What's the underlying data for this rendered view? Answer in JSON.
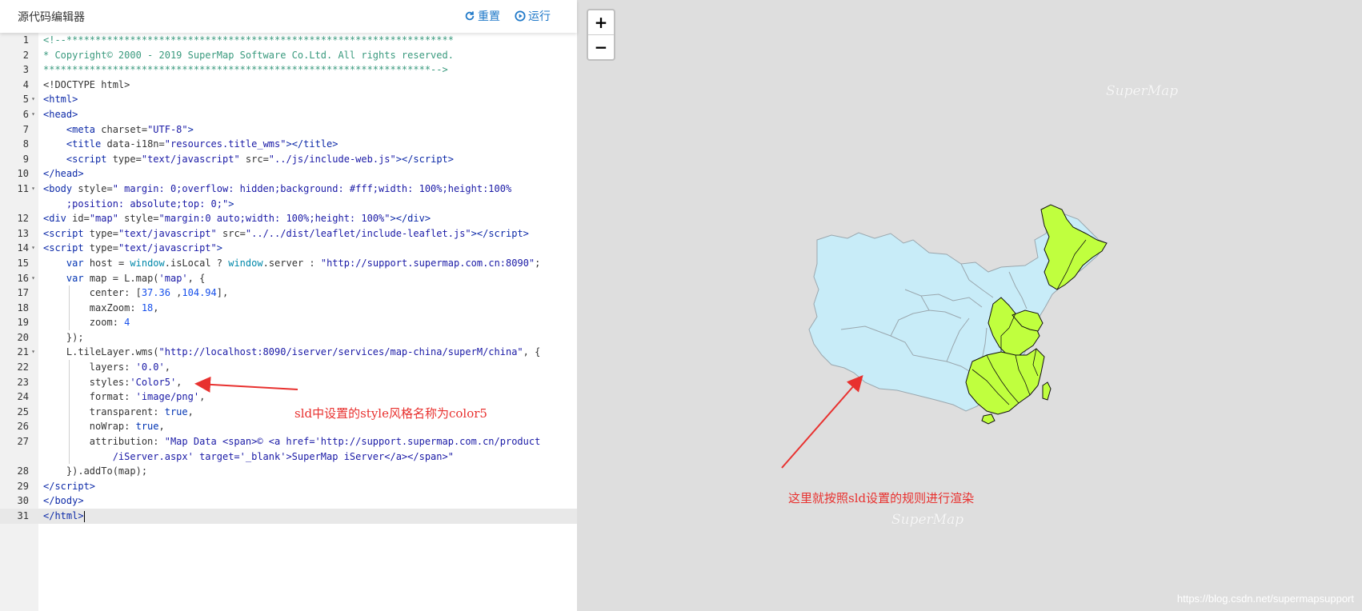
{
  "editor": {
    "title": "源代码编辑器",
    "reset_label": "重置",
    "run_label": "运行",
    "lines": [
      {
        "n": "1",
        "fold": "",
        "html": "<span class=\"c-cm\">&lt;!--*******************************************************************</span>"
      },
      {
        "n": "2",
        "fold": "",
        "html": "<span class=\"c-cm\">* Copyright© 2000 - 2019 SuperMap Software Co.Ltd. All rights reserved.</span>"
      },
      {
        "n": "3",
        "fold": "",
        "html": "<span class=\"c-cm\">*******************************************************************--&gt;</span>"
      },
      {
        "n": "4",
        "fold": "",
        "html": "&lt;!DOCTYPE html&gt;"
      },
      {
        "n": "5",
        "fold": "▾",
        "html": "<span class=\"c-tg\">&lt;html&gt;</span>"
      },
      {
        "n": "6",
        "fold": "▾",
        "html": "<span class=\"c-tg\">&lt;head&gt;</span>"
      },
      {
        "n": "7",
        "fold": "",
        "html": "    <span class=\"c-tg\">&lt;meta</span> charset=<span class=\"c-st\">\"UTF-8\"</span><span class=\"c-tg\">&gt;</span>"
      },
      {
        "n": "8",
        "fold": "",
        "html": "    <span class=\"c-tg\">&lt;title</span> data-i18n=<span class=\"c-st\">\"resources.title_wms\"</span><span class=\"c-tg\">&gt;&lt;/title&gt;</span>"
      },
      {
        "n": "9",
        "fold": "",
        "html": "    <span class=\"c-tg\">&lt;script</span> type=<span class=\"c-st\">\"text/javascript\"</span> src=<span class=\"c-st\">\"../js/include-web.js\"</span><span class=\"c-tg\">&gt;&lt;/script&gt;</span>"
      },
      {
        "n": "10",
        "fold": "",
        "html": "<span class=\"c-tg\">&lt;/head&gt;</span>"
      },
      {
        "n": "11",
        "fold": "▾",
        "html": "<span class=\"c-tg\">&lt;body</span> style=<span class=\"c-st\">\" margin: 0;overflow: hidden;background: #fff;width: 100%;height:100%</span>"
      },
      {
        "n": "",
        "fold": "",
        "html": "    <span class=\"c-st\">;position: absolute;top: 0;\"</span><span class=\"c-tg\">&gt;</span>"
      },
      {
        "n": "12",
        "fold": "",
        "html": "<span class=\"c-tg\">&lt;div</span> id=<span class=\"c-st\">\"map\"</span> style=<span class=\"c-st\">\"margin:0 auto;width: 100%;height: 100%\"</span><span class=\"c-tg\">&gt;&lt;/div&gt;</span>"
      },
      {
        "n": "13",
        "fold": "",
        "html": "<span class=\"c-tg\">&lt;script</span> type=<span class=\"c-st\">\"text/javascript\"</span> src=<span class=\"c-st\">\"../../dist/leaflet/include-leaflet.js\"</span><span class=\"c-tg\">&gt;&lt;/script&gt;</span>"
      },
      {
        "n": "14",
        "fold": "▾",
        "html": "<span class=\"c-tg\">&lt;script</span> type=<span class=\"c-st\">\"text/javascript\"</span><span class=\"c-tg\">&gt;</span>"
      },
      {
        "n": "15",
        "fold": "",
        "html": "    <span class=\"c-kw\">var</span> host = <span class=\"c-gl\">window</span>.isLocal ? <span class=\"c-gl\">window</span>.server : <span class=\"c-st\">\"http://support.supermap.com.cn:8090\"</span>;"
      },
      {
        "n": "16",
        "fold": "▾",
        "html": "    <span class=\"c-kw\">var</span> map = L.map(<span class=\"c-st\">'map'</span>, {"
      },
      {
        "n": "17",
        "fold": "",
        "guide": true,
        "html": "        center: [<span class=\"c-nu\">37.36</span> ,<span class=\"c-nu\">104.94</span>],"
      },
      {
        "n": "18",
        "fold": "",
        "guide": true,
        "html": "        maxZoom: <span class=\"c-nu\">18</span>,"
      },
      {
        "n": "19",
        "fold": "",
        "guide": true,
        "html": "        zoom: <span class=\"c-nu\">4</span>"
      },
      {
        "n": "20",
        "fold": "",
        "html": "    });"
      },
      {
        "n": "21",
        "fold": "▾",
        "html": "    L.tileLayer.wms(<span class=\"c-st\">\"http://localhost:8090/iserver/services/map-china/superM/china\"</span>, {"
      },
      {
        "n": "22",
        "fold": "",
        "guide": true,
        "html": "        layers: <span class=\"c-st\">'0.0'</span>,"
      },
      {
        "n": "23",
        "fold": "",
        "guide": true,
        "html": "        styles:<span class=\"c-st\">'Color5'</span>,"
      },
      {
        "n": "24",
        "fold": "",
        "guide": true,
        "html": "        format: <span class=\"c-st\">'image/png'</span>,"
      },
      {
        "n": "25",
        "fold": "",
        "guide": true,
        "html": "        transparent: <span class=\"c-kw\">true</span>,"
      },
      {
        "n": "26",
        "fold": "",
        "guide": true,
        "html": "        noWrap: <span class=\"c-kw\">true</span>,"
      },
      {
        "n": "27",
        "fold": "",
        "guide": true,
        "html": "        attribution: <span class=\"c-st\">\"Map Data &lt;span&gt;© &lt;a href='http://support.supermap.com.cn/product</span>"
      },
      {
        "n": "",
        "fold": "",
        "guide": true,
        "html": "            <span class=\"c-st\">/iServer.aspx' target='_blank'&gt;SuperMap iServer&lt;/a&gt;&lt;/span&gt;\"</span>"
      },
      {
        "n": "28",
        "fold": "",
        "html": "    }).addTo(map);"
      },
      {
        "n": "29",
        "fold": "",
        "html": "<span class=\"c-tg\">&lt;/script&gt;</span>"
      },
      {
        "n": "30",
        "fold": "",
        "html": "<span class=\"c-tg\">&lt;/body&gt;</span>"
      },
      {
        "n": "31",
        "fold": "",
        "active": true,
        "html": "<span class=\"c-tg\">&lt;/html&gt;</span><span class=\"cursor\"></span>"
      }
    ]
  },
  "annotations": {
    "code_note": "sld中设置的style风格名称为color5",
    "map_note": "这里就按照sld设置的规则进行渲染"
  },
  "map": {
    "zoom_in": "+",
    "zoom_out": "−",
    "watermark": "SuperMap",
    "credit": "https://blog.csdn.net/supermapsupport",
    "colors": {
      "base_fill": "#c8ecf8",
      "highlight_fill": "#c0ff3e",
      "border": "#9aa7ae",
      "highlight_border": "#111111",
      "background": "#dedede",
      "accent": "#1e78c8",
      "annotation": "#e8312f"
    }
  }
}
